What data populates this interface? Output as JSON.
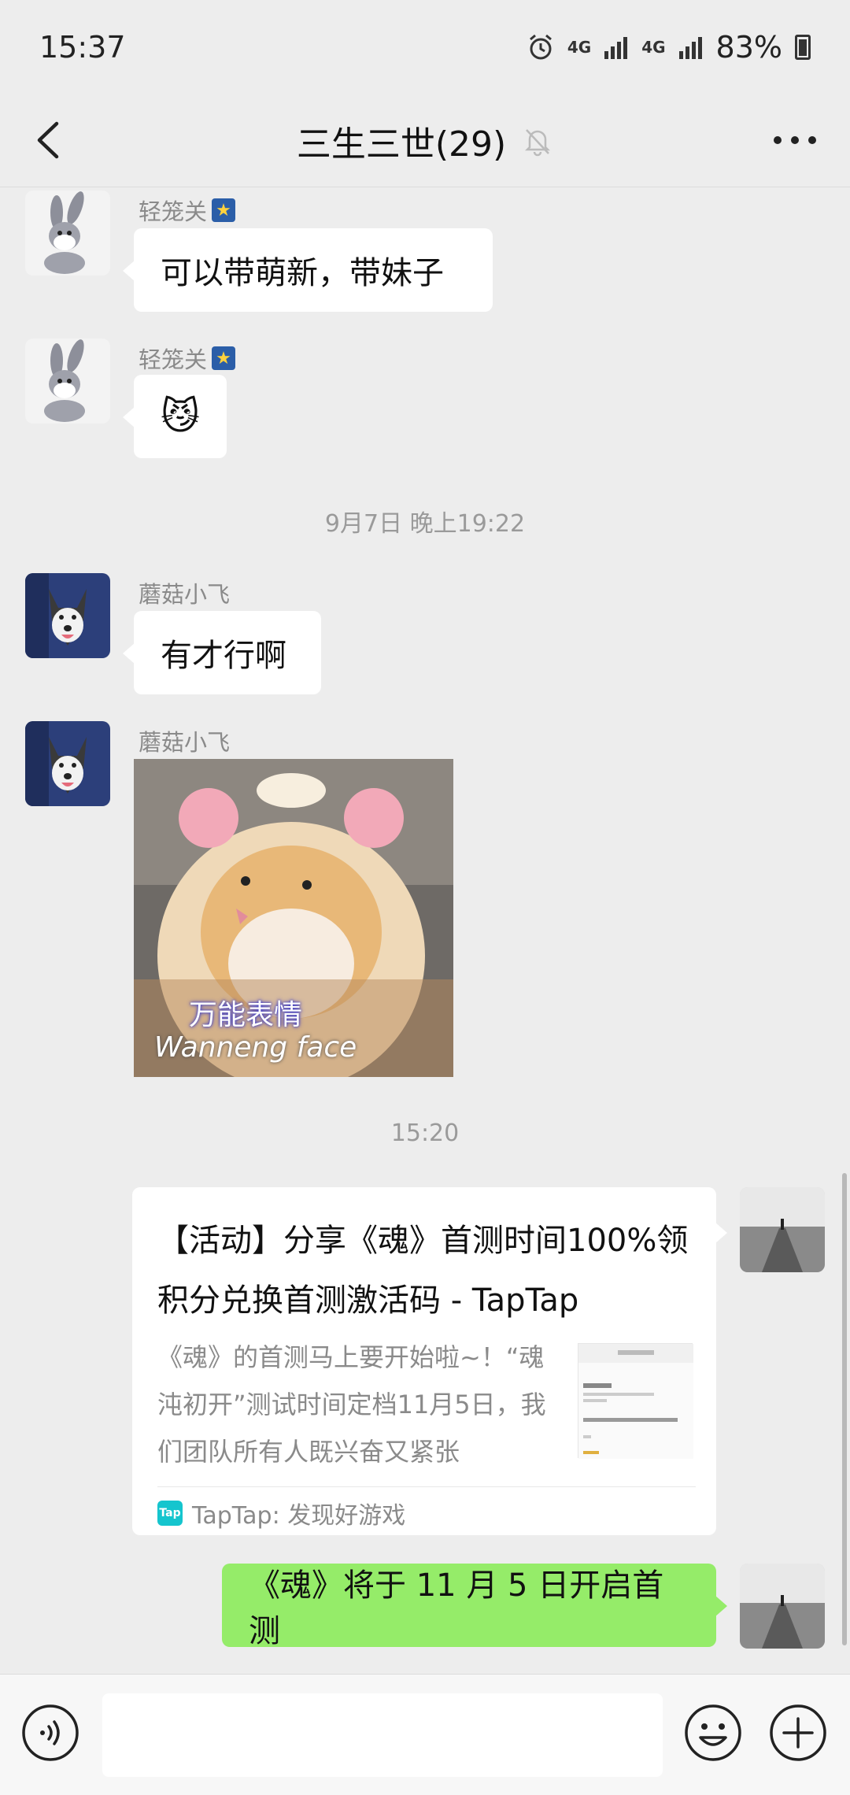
{
  "status_bar": {
    "time": "15:37",
    "alarm_icon": "alarm-clock-icon",
    "network1": "4G",
    "network2": "4G",
    "battery": "83%"
  },
  "header": {
    "title": "三生三世(29)",
    "back_icon": "chevron-left-icon",
    "mute_icon": "bell-off-icon",
    "more_icon": "more-dots-icon"
  },
  "messages": [
    {
      "sender": "轻笼关",
      "text": "可以带萌新，带妹子"
    },
    {
      "sender": "轻笼关",
      "text": "😼"
    },
    {
      "sender": "蘑菇小飞",
      "text": "有才行啊"
    },
    {
      "sender": "蘑菇小飞",
      "sticker_cn": "万能表情",
      "sticker_en": "Wanneng face"
    }
  ],
  "time_separators": [
    "9月7日 晚上19:22",
    "15:20"
  ],
  "link_card": {
    "title": "【活动】分享《魂》首测时间100%领积分兑换首测激活码 - TapTap",
    "desc": "《魂》的首测马上要开始啦~！“魂沌初开”测试时间定档11月5日，我们团队所有人既兴奋又紧张",
    "source": "TapTap: 发现好游戏",
    "source_logo": "Tap"
  },
  "my_message": "《魂》将于 11 月 5 日开启首测",
  "input_bar": {
    "voice_icon": "voice-icon",
    "emoji_icon": "emoji-icon",
    "plus_icon": "plus-icon",
    "placeholder": ""
  },
  "colors": {
    "background": "#ededed",
    "my_bubble": "#95ec69",
    "other_bubble": "#ffffff"
  }
}
